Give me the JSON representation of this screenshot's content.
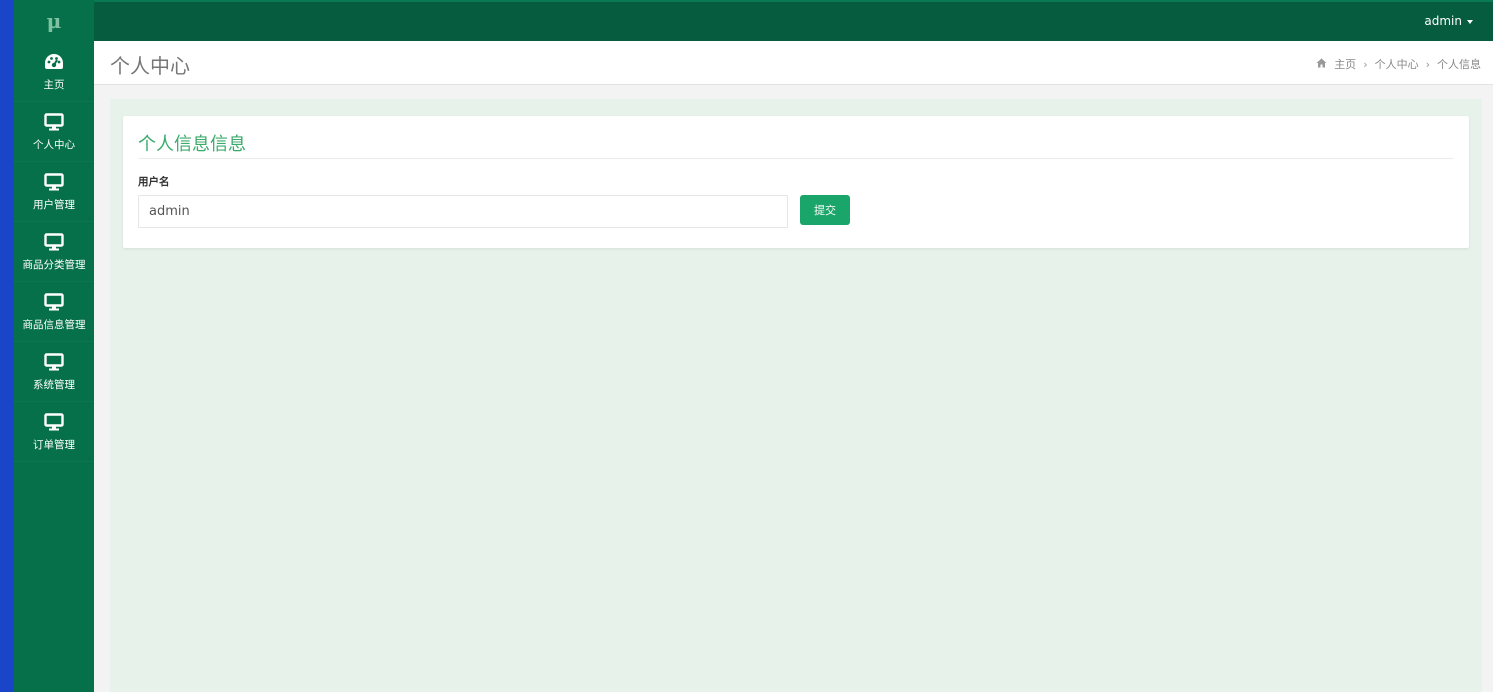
{
  "logo": "μ",
  "sidebar": {
    "items": [
      {
        "label": "主页",
        "icon": "dashboard-icon"
      },
      {
        "label": "个人中心",
        "icon": "monitor-icon"
      },
      {
        "label": "用户管理",
        "icon": "monitor-icon"
      },
      {
        "label": "商品分类管理",
        "icon": "monitor-icon"
      },
      {
        "label": "商品信息管理",
        "icon": "monitor-icon"
      },
      {
        "label": "系统管理",
        "icon": "monitor-icon"
      },
      {
        "label": "订单管理",
        "icon": "monitor-icon"
      }
    ]
  },
  "topbar": {
    "user": "admin"
  },
  "header": {
    "title": "个人中心",
    "breadcrumb": [
      "主页",
      "个人中心",
      "个人信息"
    ]
  },
  "form": {
    "title": "个人信息信息",
    "username_label": "用户名",
    "username_value": "admin",
    "submit_label": "提交"
  },
  "colors": {
    "sidebar": "#06704a",
    "topbar": "#055c3e",
    "accent": "#3bab6b",
    "button": "#1aa56a",
    "content_bg": "#e6f2ea"
  }
}
